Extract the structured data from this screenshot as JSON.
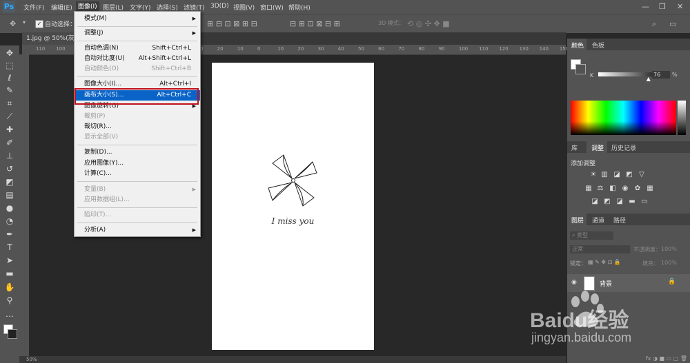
{
  "app": {
    "logo": "Ps"
  },
  "menubar": {
    "items": [
      "文件(F)",
      "编辑(E)",
      "图像(I)",
      "图层(L)",
      "文字(Y)",
      "选择(S)",
      "滤镜(T)",
      "3D(D)",
      "视图(V)",
      "窗口(W)",
      "帮助(H)"
    ]
  },
  "window_controls": {
    "minimize": "—",
    "restore": "❐",
    "close": "✕"
  },
  "options_bar": {
    "auto_select_label": "自动选择：",
    "mode_3d_label": "3D 模式："
  },
  "document": {
    "tab_title": "1.jpg @ 50%(灰色",
    "zoom": "50%",
    "caption": "I miss you"
  },
  "image_menu": {
    "items": [
      {
        "label": "模式(M)",
        "shortcut": "",
        "submenu": true,
        "disabled": false
      },
      {
        "label": "调整(J)",
        "shortcut": "",
        "submenu": true,
        "disabled": false
      },
      {
        "label": "自动色调(N)",
        "shortcut": "Shift+Ctrl+L",
        "submenu": false,
        "disabled": false
      },
      {
        "label": "自动对比度(U)",
        "shortcut": "Alt+Shift+Ctrl+L",
        "submenu": false,
        "disabled": false
      },
      {
        "label": "自动颜色(O)",
        "shortcut": "Shift+Ctrl+B",
        "submenu": false,
        "disabled": true
      },
      {
        "label": "图像大小(I)...",
        "shortcut": "Alt+Ctrl+I",
        "submenu": false,
        "disabled": false
      },
      {
        "label": "画布大小(S)...",
        "shortcut": "Alt+Ctrl+C",
        "submenu": false,
        "disabled": false,
        "highlighted": true
      },
      {
        "label": "图像旋转(G)",
        "shortcut": "",
        "submenu": true,
        "disabled": false
      },
      {
        "label": "裁剪(P)",
        "shortcut": "",
        "submenu": false,
        "disabled": true
      },
      {
        "label": "裁切(R)...",
        "shortcut": "",
        "submenu": false,
        "disabled": false
      },
      {
        "label": "显示全部(V)",
        "shortcut": "",
        "submenu": false,
        "disabled": true
      },
      {
        "label": "复制(D)...",
        "shortcut": "",
        "submenu": false,
        "disabled": false
      },
      {
        "label": "应用图像(Y)...",
        "shortcut": "",
        "submenu": false,
        "disabled": false
      },
      {
        "label": "计算(C)...",
        "shortcut": "",
        "submenu": false,
        "disabled": false
      },
      {
        "label": "变量(B)",
        "shortcut": "",
        "submenu": true,
        "disabled": true
      },
      {
        "label": "应用数据组(L)...",
        "shortcut": "",
        "submenu": false,
        "disabled": true
      },
      {
        "label": "陷印(T)...",
        "shortcut": "",
        "submenu": false,
        "disabled": true
      },
      {
        "label": "分析(A)",
        "shortcut": "",
        "submenu": true,
        "disabled": false
      }
    ]
  },
  "color_panel": {
    "tabs": [
      "颜色",
      "色板"
    ],
    "channel": "K",
    "value": "76",
    "unit": "%",
    "slider_level_percent": 76
  },
  "adjust_panel": {
    "tabs": [
      "库",
      "调整",
      "历史记录"
    ],
    "add_label": "添加调整"
  },
  "layers_panel": {
    "tabs": [
      "图层",
      "通道",
      "路径"
    ],
    "filter_kind": "类型",
    "blend_mode": "正常",
    "opacity_label": "不透明度：",
    "opacity_value": "100%",
    "lock_label": "锁定：",
    "fill_label": "填充：",
    "fill_value": "100%",
    "layers": [
      {
        "name": "背景"
      }
    ]
  },
  "ruler": {
    "h_ticks": [
      "110",
      "100",
      "90",
      "80",
      "70",
      "60",
      "50",
      "40",
      "30",
      "20",
      "10",
      "0",
      "10",
      "20",
      "30",
      "40",
      "50",
      "60",
      "70",
      "80",
      "90",
      "100",
      "110",
      "120",
      "130",
      "140",
      "150"
    ]
  },
  "watermark": {
    "brand": "Baidu经验",
    "url": "jingyan.baidu.com"
  },
  "colors": {
    "highlight": "#0a64c8",
    "annotation_box": "#c0101c",
    "ps_blue": "#31a8ff"
  }
}
